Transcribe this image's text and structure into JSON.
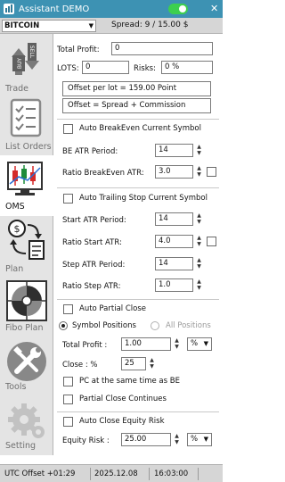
{
  "window": {
    "title": "Assistant DEMO"
  },
  "symbol": {
    "selected": "BITCOIN",
    "spread_text": "Spread: 9 / 15.00 $"
  },
  "sidebar": {
    "items": [
      {
        "label": "Trade",
        "icon": "buy-sell-arrows-icon"
      },
      {
        "label": "List Orders",
        "icon": "checklist-icon"
      },
      {
        "label": "OMS",
        "icon": "candlestick-chart-icon"
      },
      {
        "label": "Plan",
        "icon": "plan-flow-icon"
      },
      {
        "label": "Fibo Plan",
        "icon": "fibonacci-spiral-icon"
      },
      {
        "label": "Tools",
        "icon": "wrench-screwdriver-icon"
      },
      {
        "label": "Setting",
        "icon": "gear-icon"
      }
    ]
  },
  "summary": {
    "total_profit_label": "Total Profit:",
    "total_profit_value": "0",
    "lots_label": "LOTS:",
    "lots_value": "0",
    "risks_label": "Risks:",
    "risks_value": "0 %",
    "offset_per_lot": "Offset per lot =  159.00  Point",
    "offset_formula": "Offset = Spread + Commission"
  },
  "breakeven": {
    "title": "Auto BreakEven Current Symbol",
    "atr_period_label": "BE ATR Period:",
    "atr_period_value": "14",
    "ratio_label": "Ratio BreakEven ATR:",
    "ratio_value": "3.0"
  },
  "trailing": {
    "title": "Auto Trailing Stop Current Symbol",
    "start_atr_period_label": "Start ATR Period:",
    "start_atr_period_value": "14",
    "ratio_start_label": "Ratio Start ATR:",
    "ratio_start_value": "4.0",
    "step_atr_period_label": "Step ATR Period:",
    "step_atr_period_value": "14",
    "ratio_step_label": "Ratio Step ATR:",
    "ratio_step_value": "1.0"
  },
  "partial": {
    "title": "Auto Partial Close",
    "symbol_positions": "Symbol Positions",
    "all_positions": "All Positions",
    "total_profit_label": "Total Profit :",
    "total_profit_value": "1.00",
    "total_profit_unit": "%",
    "close_label": "Close : %",
    "close_value": "25",
    "pc_same_time": "PC at the same time as BE",
    "pc_continues": "Partial Close Continues"
  },
  "equity": {
    "title": "Auto Close Equity Risk",
    "risk_label": "Equity Risk :",
    "risk_value": "25.00",
    "risk_unit": "%"
  },
  "status": {
    "utc_offset": "UTC Offset  +01:29",
    "date": "2025.12.08",
    "time": "16:03:00"
  },
  "colors": {
    "titlebar": "#3d92b3",
    "toggle_on": "#3ccf4e",
    "sidebar_bg": "#e4e4e4"
  }
}
